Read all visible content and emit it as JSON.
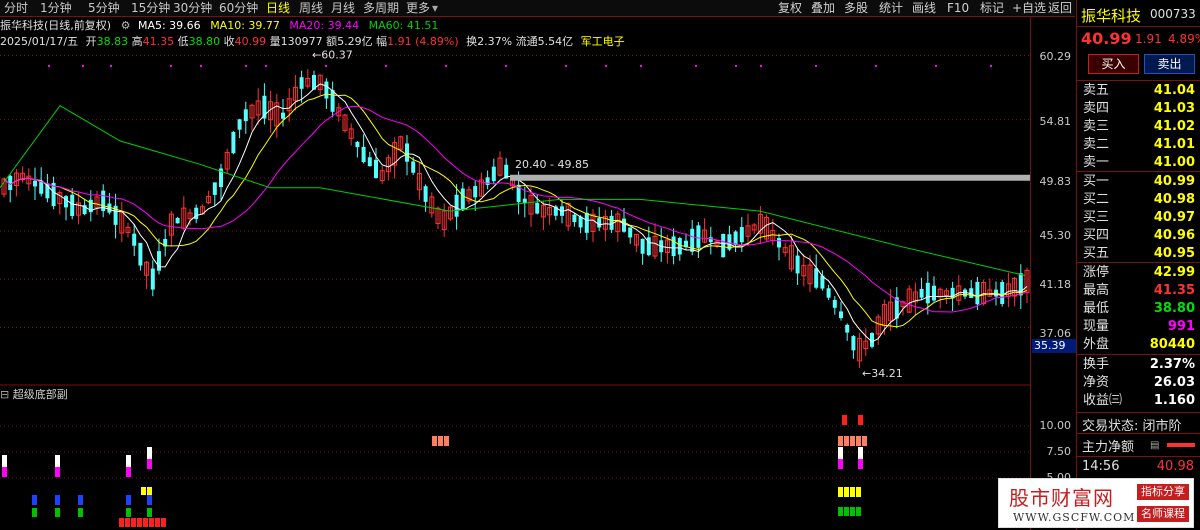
{
  "toolbar": {
    "left": [
      "分时",
      "1分钟",
      "5分钟",
      "15分钟",
      "30分钟",
      "60分钟",
      "日线",
      "周线",
      "月线",
      "多周期",
      "更多"
    ],
    "right": [
      "复权",
      "叠加",
      "多股",
      "统计",
      "画线",
      "F10",
      "标记",
      "+自选",
      "返回"
    ],
    "more_arrow": "▾",
    "active_index": 6
  },
  "info": {
    "stock": "振华科技(日线,前复权)",
    "ma5": "MA5: 39.66",
    "ma10": "MA10: 39.77",
    "ma20": "MA20: 39.44",
    "ma60": "MA60: 41.51",
    "date": "2025/01/17/五",
    "open_l": "开",
    "open": "38.83",
    "high_l": "高",
    "high": "41.35",
    "low_l": "低",
    "low": "38.80",
    "close_l": "收",
    "close": "40.99",
    "vol_l": "量",
    "vol": "130977",
    "amt_l": "额",
    "amt": "5.29亿",
    "chg_l": "幅",
    "chg": "1.91 (4.89%)",
    "turn": "换2.37%",
    "float": "流通5.54亿",
    "sector": "军工电子"
  },
  "chart": {
    "y_labels": [
      "60.29",
      "54.81",
      "49.83",
      "45.30",
      "41.18",
      "37.06"
    ],
    "current_price_tag": "35.39",
    "high_mark": "60.37",
    "low_mark": "34.21",
    "range_label": "20.40 - 49.85",
    "sub_title": "超级底部副",
    "sub_y_labels": [
      "10.00",
      "7.50",
      "5.00"
    ],
    "colors": {
      "up": "#ff3232",
      "down": "#54ffff",
      "ma5": "#ffffff",
      "ma10": "#ffff00",
      "ma20": "#ff00ff",
      "ma60": "#00d000"
    }
  },
  "panel": {
    "name": "振华科技",
    "code": "000733",
    "price": "40.99",
    "chg": "1.91",
    "pct": "4.89%",
    "buy": "买入",
    "sell": "卖出",
    "asks": [
      {
        "l": "卖五",
        "v": "41.04"
      },
      {
        "l": "卖四",
        "v": "41.03"
      },
      {
        "l": "卖三",
        "v": "41.02"
      },
      {
        "l": "卖二",
        "v": "41.01"
      },
      {
        "l": "卖一",
        "v": "41.00"
      }
    ],
    "bids": [
      {
        "l": "买一",
        "v": "40.99"
      },
      {
        "l": "买二",
        "v": "40.98"
      },
      {
        "l": "买三",
        "v": "40.97"
      },
      {
        "l": "买四",
        "v": "40.96"
      },
      {
        "l": "买五",
        "v": "40.95"
      }
    ],
    "stats": [
      {
        "l": "涨停",
        "v": "42.99"
      },
      {
        "l": "最高",
        "v": "41.35"
      },
      {
        "l": "最低",
        "v": "38.80"
      },
      {
        "l": "现量",
        "v": "991"
      },
      {
        "l": "外盘",
        "v": "80440"
      }
    ],
    "stats2": [
      {
        "l": "换手",
        "v": "2.37%"
      },
      {
        "l": "净资",
        "v": "26.03"
      },
      {
        "l": "收益㈢",
        "v": "1.160"
      }
    ],
    "status": "交易状态: 闭市阶",
    "main_net": "主力净额",
    "time": "14:56",
    "time_price": "40.98"
  },
  "watermark": {
    "title": "股市财富网",
    "url": "WWW.GSCFW.COM",
    "b1": "指标分享",
    "b2": "名师课程"
  }
}
